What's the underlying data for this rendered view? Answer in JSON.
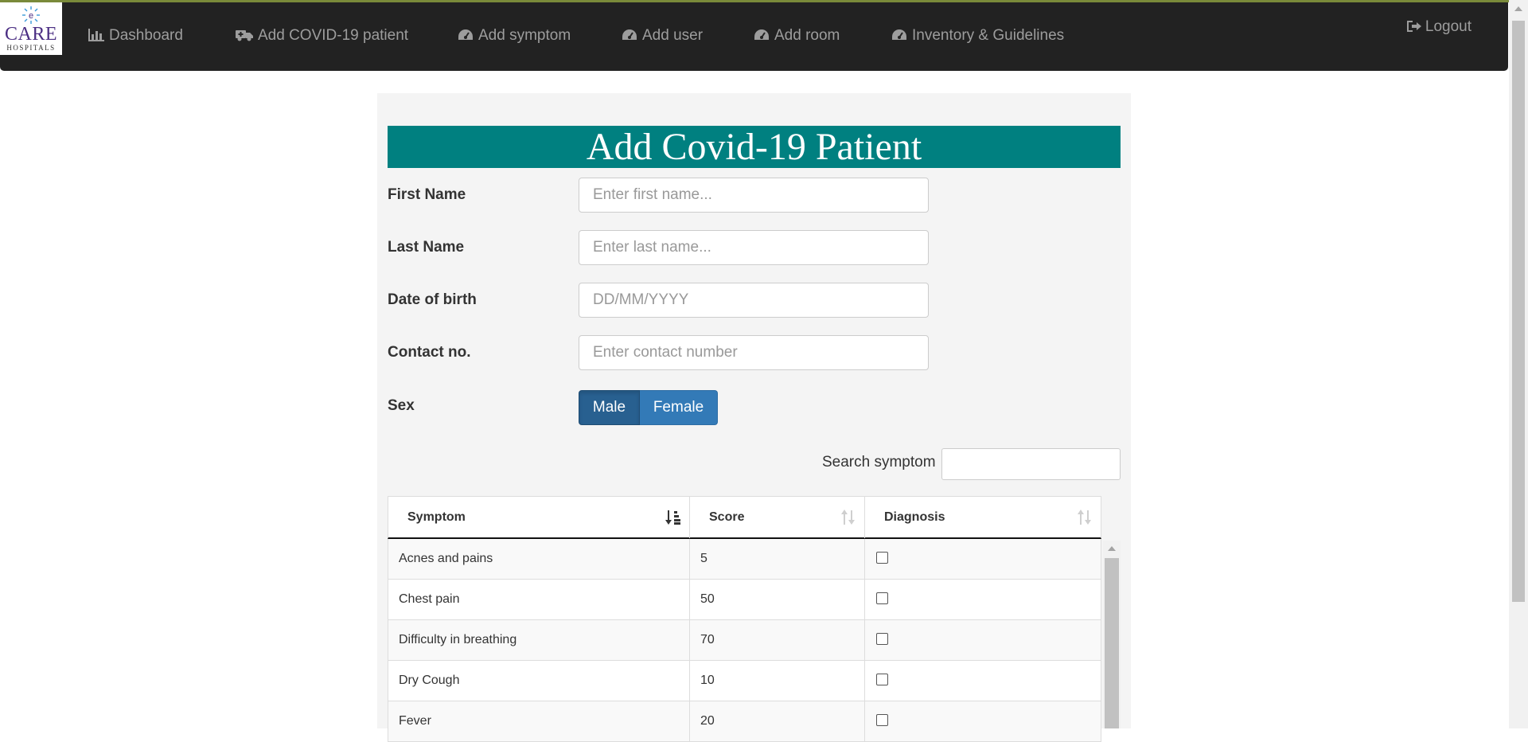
{
  "navbar": {
    "logo": {
      "brand": "CARE",
      "sub": "HOSPITALS"
    },
    "items": [
      {
        "label": "Dashboard",
        "icon": "bar-chart-icon"
      },
      {
        "label": "Add COVID-19 patient",
        "icon": "ambulance-icon"
      },
      {
        "label": "Add symptom",
        "icon": "dashboard-icon"
      },
      {
        "label": "Add user",
        "icon": "dashboard-icon"
      },
      {
        "label": "Add room",
        "icon": "dashboard-icon"
      },
      {
        "label": "Inventory & Guidelines",
        "icon": "dashboard-icon"
      }
    ],
    "logout": {
      "label": "Logout",
      "icon": "logout-icon"
    }
  },
  "form": {
    "title": "Add Covid-19 Patient",
    "fields": [
      {
        "label": "First Name",
        "placeholder": "Enter first name...",
        "value": ""
      },
      {
        "label": "Last Name",
        "placeholder": "Enter last name...",
        "value": ""
      },
      {
        "label": "Date of birth",
        "placeholder": "DD/MM/YYYY",
        "value": ""
      },
      {
        "label": "Contact no.",
        "placeholder": "Enter contact number",
        "value": ""
      }
    ],
    "sex": {
      "label": "Sex",
      "options": [
        "Male",
        "Female"
      ],
      "selected": "Male"
    }
  },
  "symptoms": {
    "search_label": "Search symptom",
    "search_value": "",
    "columns": [
      "Symptom",
      "Score",
      "Diagnosis"
    ],
    "rows": [
      {
        "symptom": "Acnes and pains",
        "score": "5",
        "checked": false
      },
      {
        "symptom": "Chest pain",
        "score": "50",
        "checked": false
      },
      {
        "symptom": "Difficulty in breathing",
        "score": "70",
        "checked": false
      },
      {
        "symptom": "Dry Cough",
        "score": "10",
        "checked": false
      },
      {
        "symptom": "Fever",
        "score": "20",
        "checked": false
      }
    ]
  },
  "colors": {
    "navbar_bg": "#222222",
    "title_bg": "#008080",
    "button_primary": "#337ab7",
    "button_active": "#286090"
  }
}
